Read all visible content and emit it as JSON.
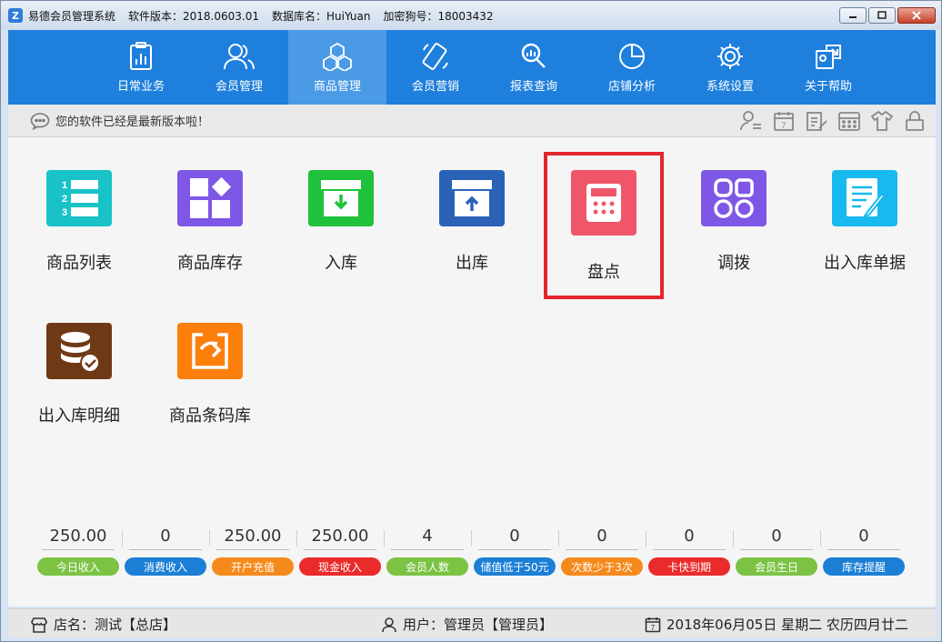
{
  "titlebar": {
    "app_icon": "Z",
    "app_name": "易德会员管理系统",
    "version": "软件版本：2018.0603.01",
    "database": "数据库名：HuiYuan",
    "dongle": "加密狗号：18003432"
  },
  "nav": {
    "items": [
      {
        "label": "日常业务",
        "icon": "clipboard-chart-icon"
      },
      {
        "label": "会员管理",
        "icon": "users-icon"
      },
      {
        "label": "商品管理",
        "icon": "cubes-icon",
        "active": true
      },
      {
        "label": "会员营销",
        "icon": "phone-icon"
      },
      {
        "label": "报表查询",
        "icon": "magnifier-icon"
      },
      {
        "label": "店铺分析",
        "icon": "pie-chart-icon"
      },
      {
        "label": "系统设置",
        "icon": "gear-icon"
      },
      {
        "label": "关于帮助",
        "icon": "help-icon"
      }
    ]
  },
  "notice": {
    "message": "您的软件已经是最新版本啦！",
    "tools": [
      "user-switch-icon",
      "calendar-icon",
      "note-edit-icon",
      "calculator-icon",
      "shirt-icon",
      "lock-icon"
    ],
    "calendar_day": "7"
  },
  "modules": [
    {
      "label": "商品列表",
      "color": "#19c2c6",
      "icon": "numbered-list-icon"
    },
    {
      "label": "商品库存",
      "color": "#7e57e6",
      "icon": "blocks-icon"
    },
    {
      "label": "入库",
      "color": "#1fc23a",
      "icon": "box-in-icon"
    },
    {
      "label": "出库",
      "color": "#2a62b8",
      "icon": "box-out-icon"
    },
    {
      "label": "盘点",
      "color": "#f0566a",
      "icon": "calculator-icon",
      "highlighted": true
    },
    {
      "label": "调拨",
      "color": "#7e57e6",
      "icon": "grid-rings-icon"
    },
    {
      "label": "出入库单据",
      "color": "#18b9ef",
      "icon": "document-pen-icon"
    },
    {
      "label": "出入库明细",
      "color": "#6e3a16",
      "icon": "database-check-icon"
    },
    {
      "label": "商品条码库",
      "color": "#fb7f0a",
      "icon": "import-icon"
    }
  ],
  "stats": [
    {
      "value": "250.00",
      "label": "今日收入",
      "color": "#7cc344"
    },
    {
      "value": "0",
      "label": "消费收入",
      "color": "#1c7fd6"
    },
    {
      "value": "250.00",
      "label": "开户充值",
      "color": "#f58a1c"
    },
    {
      "value": "250.00",
      "label": "现金收入",
      "color": "#ea2b2b"
    },
    {
      "value": "4",
      "label": "会员人数",
      "color": "#7cc344"
    },
    {
      "value": "0",
      "label": "储值低于50元",
      "color": "#1c7fd6"
    },
    {
      "value": "0",
      "label": "次数少于3次",
      "color": "#f58a1c"
    },
    {
      "value": "0",
      "label": "卡快到期",
      "color": "#ea2b2b"
    },
    {
      "value": "0",
      "label": "会员生日",
      "color": "#7cc344"
    },
    {
      "value": "0",
      "label": "库存提醒",
      "color": "#1c7fd6"
    }
  ],
  "status": {
    "store": "店名：测试【总店】",
    "user": "用户：管理员【管理员】",
    "date": "2018年06月05日 星期二 农历四月廿二",
    "calendar_day": "7"
  }
}
